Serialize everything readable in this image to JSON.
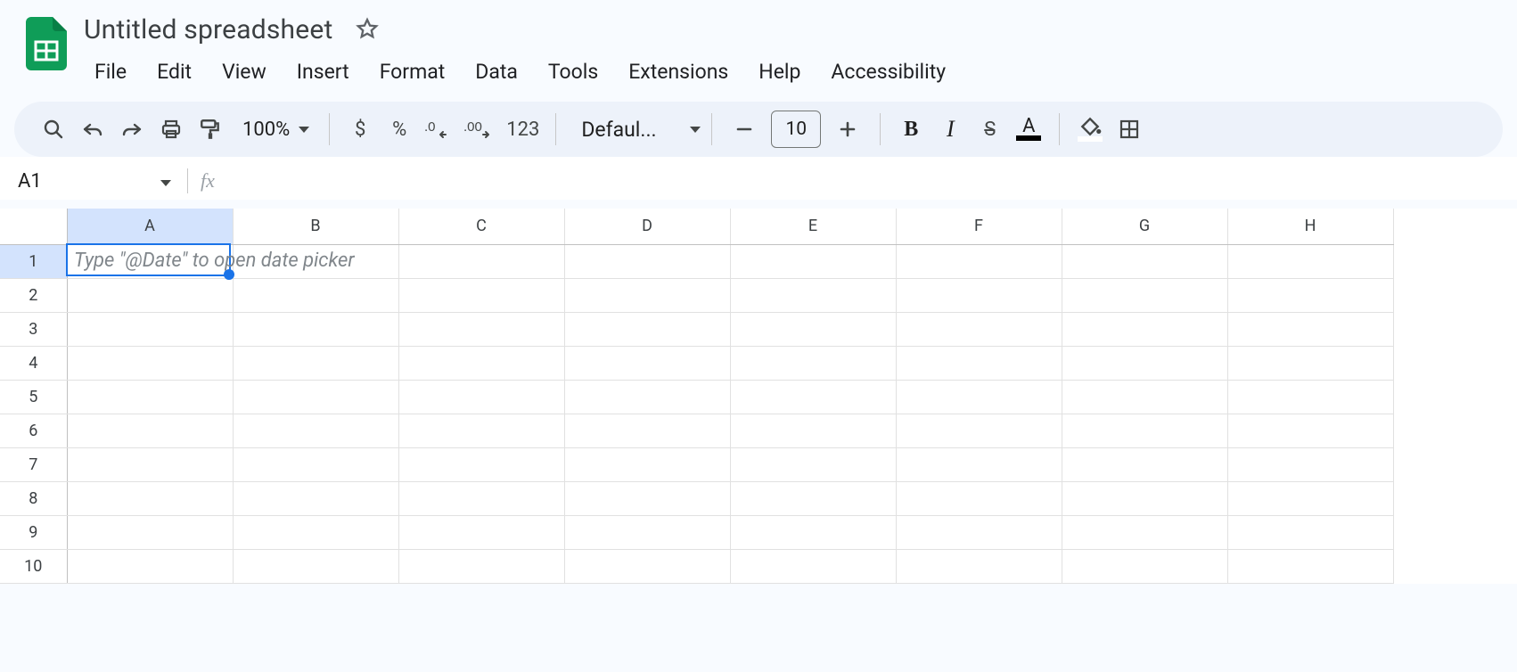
{
  "header": {
    "title": "Untitled spreadsheet"
  },
  "menubar": {
    "items": [
      "File",
      "Edit",
      "View",
      "Insert",
      "Format",
      "Data",
      "Tools",
      "Extensions",
      "Help",
      "Accessibility"
    ]
  },
  "toolbar": {
    "zoom": "100%",
    "currency": "$",
    "percent": "%",
    "numfmt": "123",
    "font_label": "Defaul...",
    "font_size": "10",
    "bold": "B",
    "italic": "I",
    "strike": "S",
    "textcolor_letter": "A"
  },
  "namebox": {
    "ref": "A1",
    "fx": "fx"
  },
  "grid": {
    "columns": [
      "A",
      "B",
      "C",
      "D",
      "E",
      "F",
      "G",
      "H"
    ],
    "rows": [
      "1",
      "2",
      "3",
      "4",
      "5",
      "6",
      "7",
      "8",
      "9",
      "10"
    ],
    "active_cell_placeholder": "Type \"@Date\" to open date picker",
    "selected_col_index": 0,
    "selected_row_index": 0
  }
}
